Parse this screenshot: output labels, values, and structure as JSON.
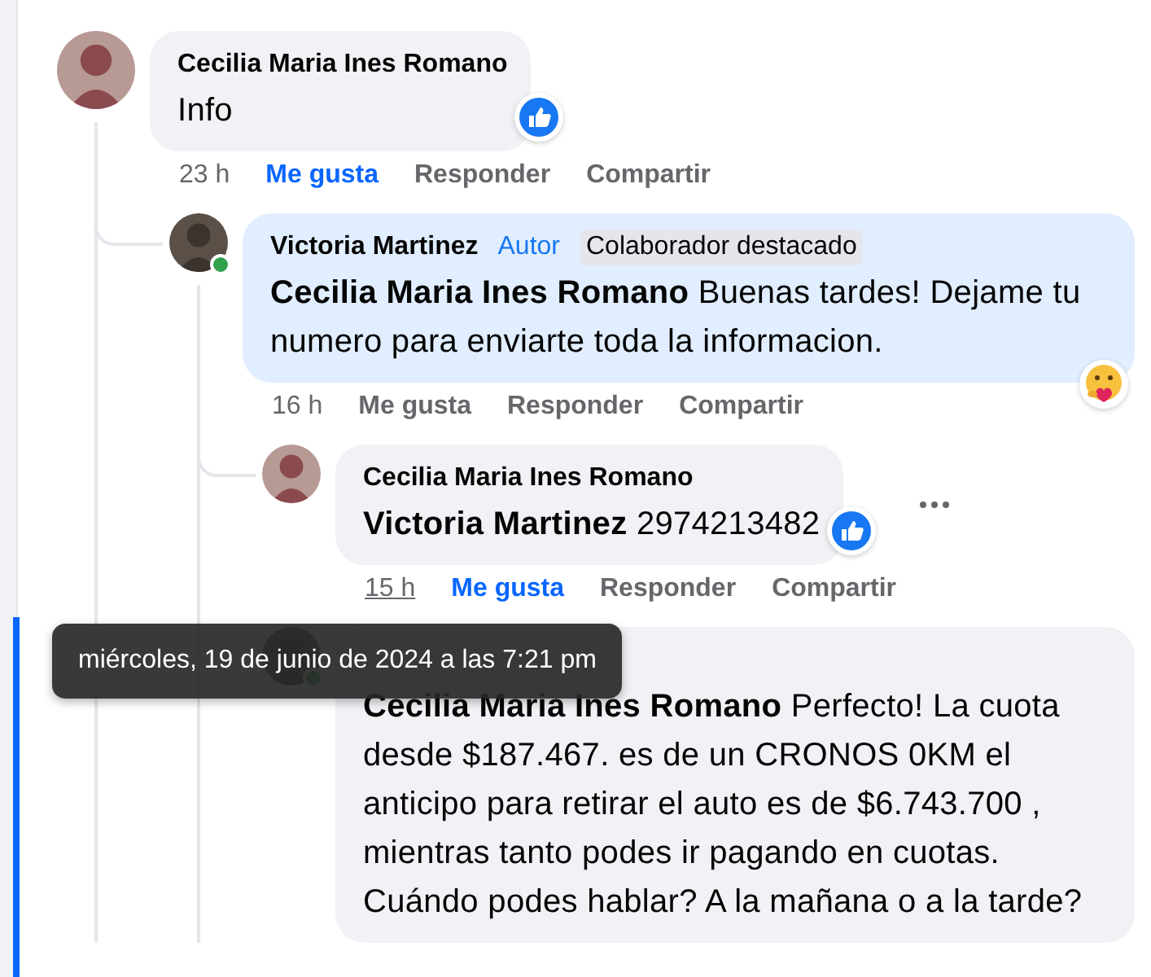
{
  "comments": [
    {
      "author": "Cecilia Maria Ines Romano",
      "text": "Info",
      "reaction": {
        "kind": "like"
      },
      "time": "23 h",
      "liked": true,
      "actions": [
        "Me gusta",
        "Responder",
        "Compartir"
      ],
      "children": [
        {
          "author": "Victoria Martinez",
          "role": "Autor",
          "badge": "Colaborador destacado",
          "text": "**Cecilia Maria Ines Romano** Buenas tardes! Dejame tu numero para enviarte toda la informacion.",
          "reaction": {
            "kind": "care"
          },
          "time": "16 h",
          "liked": false,
          "actions": [
            "Me gusta",
            "Responder",
            "Compartir"
          ],
          "online": true,
          "highlighted": true,
          "children": [
            {
              "author": "Cecilia Maria Ines Romano",
              "text": "**Victoria Martinez** 2974213482",
              "reaction": {
                "kind": "like"
              },
              "time": "15 h",
              "time_hovered": true,
              "tooltip": "miércoles, 19 de junio de 2024 a las 7:21 pm",
              "liked": true,
              "actions": [
                "Me gusta",
                "Responder",
                "Compartir"
              ],
              "more_button": true
            },
            {
              "text": "**Cecilia Maria Ines Romano** Perfecto! La cuota desde $187.467. es de un CRONOS 0KM el anticipo para retirar el auto es de $6.743.700 , mientras tanto podes ir pagando en cuotas. Cuándo podes hablar? A la mañana o a la tarde?",
              "online": true,
              "focused": true
            }
          ]
        }
      ]
    }
  ]
}
